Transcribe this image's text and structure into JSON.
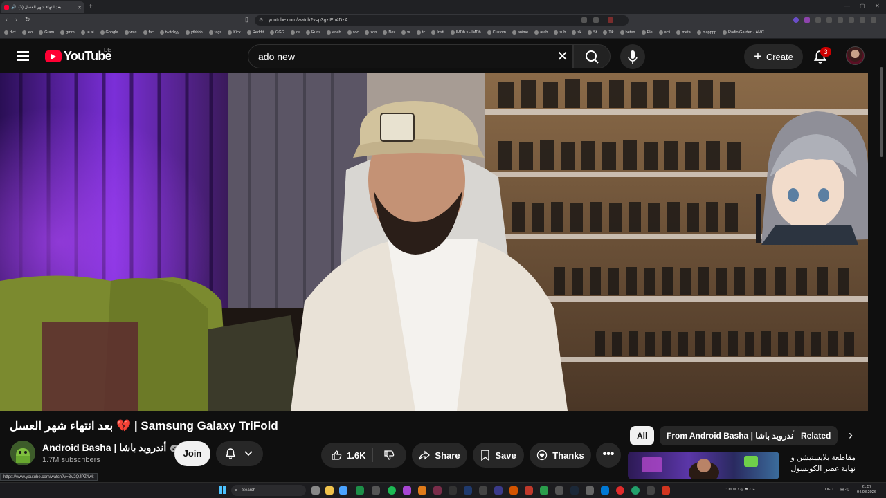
{
  "browser": {
    "tab_title": "(3) بعد انتهاء شهر العسل",
    "new_tab": "+",
    "url": "youtube.com/watch?v=p3gztEh4DzA",
    "bookmarks": [
      "dict",
      "leo",
      "Gram",
      "gmm",
      "re ai",
      "Google",
      "was",
      "fac",
      "twitchyy",
      "ytbbbb",
      "tags",
      "Kick",
      "Reddit",
      "GGG",
      "re",
      "Runs",
      "eneb",
      "soc",
      "zon",
      "Nex",
      "vr",
      "tc",
      "Insti",
      "IMDb s - IMDb",
      "Custom",
      "anime",
      "arab",
      "sub",
      "sk",
      "St",
      "Tik",
      "beten",
      "Ele",
      "acti",
      "meta",
      "mapppp",
      "Radio Garden - AMC"
    ]
  },
  "youtube": {
    "logo_text": "YouTube",
    "country_code": "DE",
    "search_query": "ado new",
    "create_label": "Create",
    "notification_count": "3"
  },
  "video": {
    "title_arabic": "بعد انتهاء شهر العسل",
    "title_heart": "💔",
    "title_english": "| Samsung Galaxy TriFold",
    "channel_name": "Android Basha | أندرويد باشا",
    "subscribers": "1.7M subscribers",
    "join_label": "Join",
    "like_count": "1.6K",
    "share_label": "Share",
    "save_label": "Save",
    "thanks_label": "Thanks",
    "more_label": "•••"
  },
  "sidebar": {
    "chips": [
      "All",
      "From Android Basha | أندرويد باشا",
      "Related"
    ],
    "next_chip": "›",
    "recommendation_title": "مقاطعة بلايستيشن و نهاية عصر الكونسول"
  },
  "status_url": "https://www.youtube.com/watch?v=3V2QJPZ4wk",
  "taskbar": {
    "search_label": "Search",
    "language": "DEU",
    "time": "21:57",
    "date": "04.08.2026"
  },
  "colors": {
    "youtube_red": "#ff0033",
    "background": "#0f0f0f",
    "button_bg": "#272727",
    "notification_badge": "#cc0000"
  }
}
